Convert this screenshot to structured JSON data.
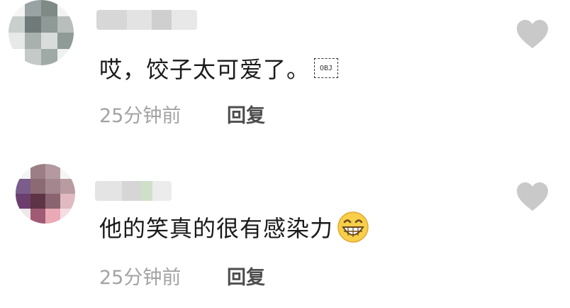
{
  "comments": [
    {
      "text": "哎，饺子太可爱了。",
      "inline_object_marker": "OBJ",
      "timestamp": "25分钟前",
      "reply_label": "回复",
      "icons": [
        "avatar-blurred",
        "heart-icon"
      ],
      "colors": {
        "heart": "#c9c9c9",
        "timestamp": "#a3a3a3",
        "reply": "#4d4d4d"
      }
    },
    {
      "text": "他的笑真的很有感染力",
      "emoji": "grinning-face-with-smiling-eyes",
      "timestamp": "25分钟前",
      "reply_label": "回复",
      "icons": [
        "avatar-blurred",
        "heart-icon"
      ],
      "colors": {
        "heart": "#c9c9c9",
        "timestamp": "#a3a3a3",
        "reply": "#4d4d4d"
      }
    }
  ]
}
